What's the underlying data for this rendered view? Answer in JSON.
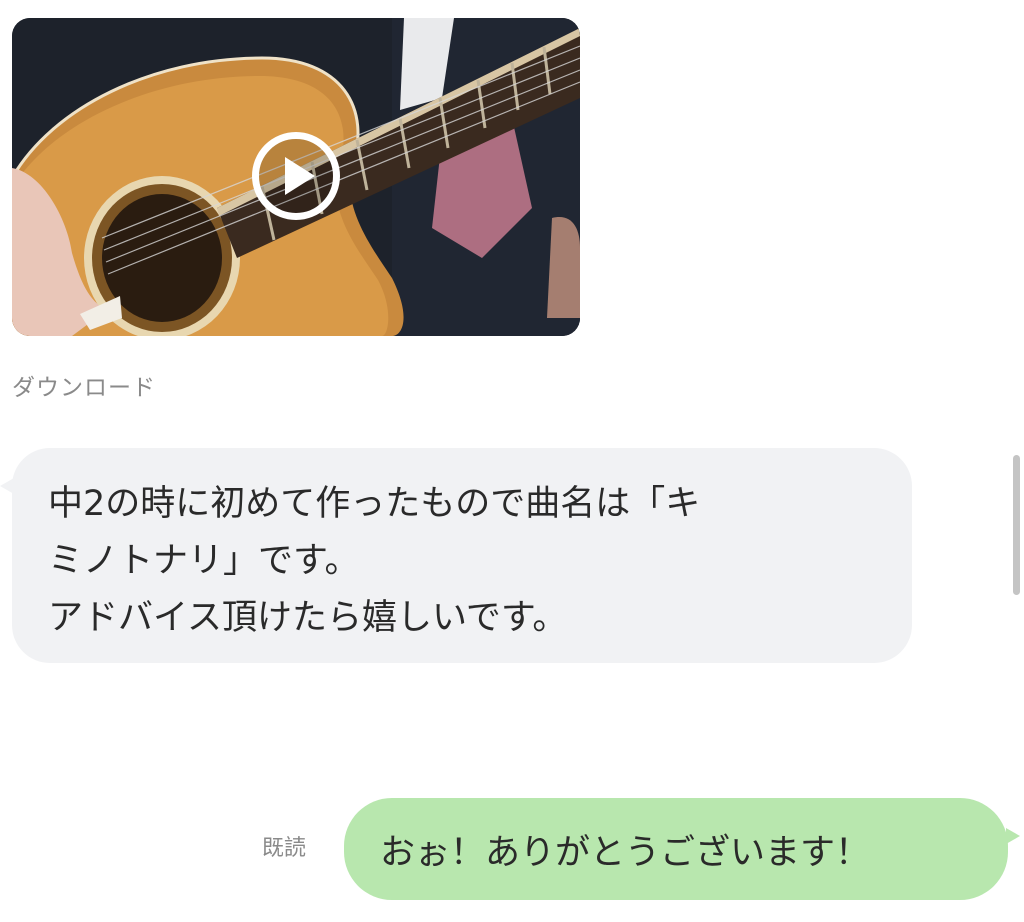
{
  "video_message": {
    "download_label": "ダウンロード"
  },
  "received_message": {
    "lines": [
      "中2の時に初めて作ったもので曲名は「キ",
      "ミノトナリ」です。",
      "アドバイス頂けたら嬉しいです。"
    ]
  },
  "sent_message": {
    "read_receipt": "既読",
    "text": "おぉ！ありがとうございます！"
  },
  "colors": {
    "received_bubble": "#f1f2f4",
    "sent_bubble": "#b8e7ae",
    "meta_text": "#8a8a8a"
  },
  "icons": {
    "play": "play-icon"
  }
}
